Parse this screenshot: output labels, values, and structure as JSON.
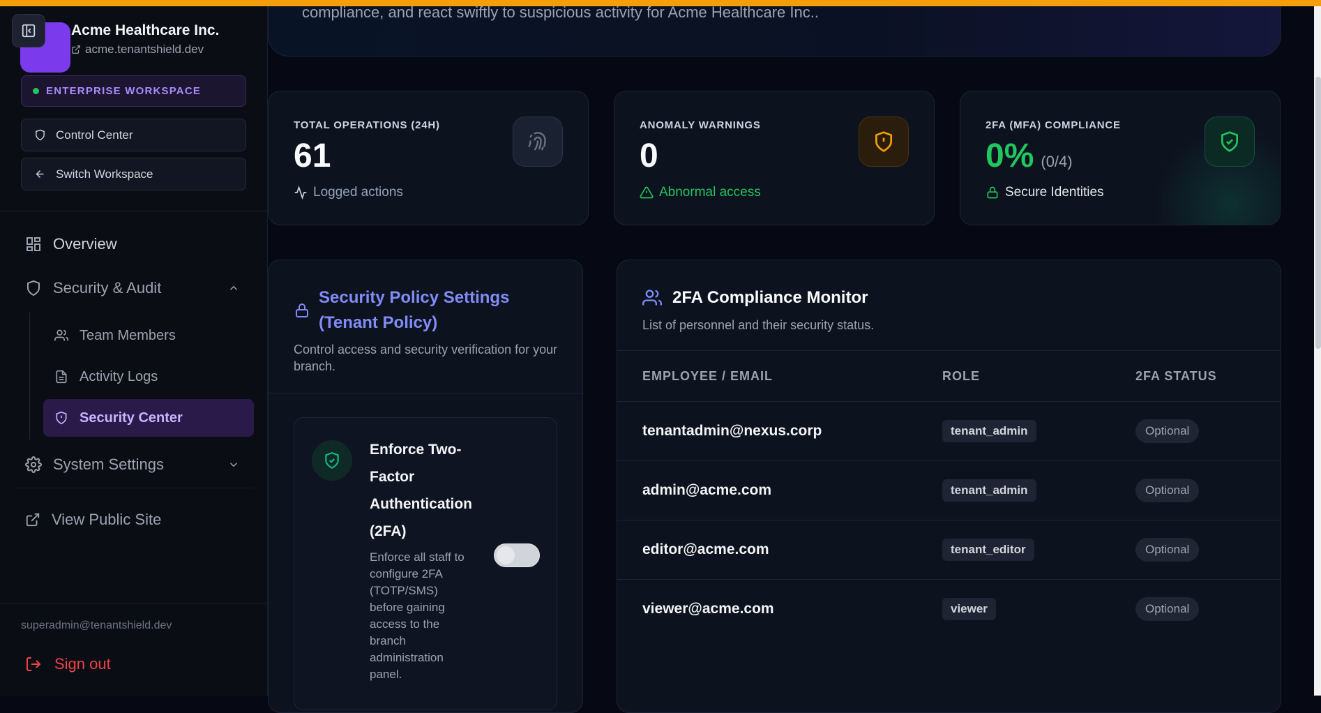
{
  "brand": {
    "name": "Acme Healthcare Inc.",
    "url": "acme.tenantshield.dev"
  },
  "workspace_badge": "ENTERPRISE WORKSPACE",
  "sidebar_buttons": {
    "control_center": "Control Center",
    "switch_workspace": "Switch Workspace"
  },
  "nav": {
    "overview": "Overview",
    "security_audit": "Security & Audit",
    "team_members": "Team Members",
    "activity_logs": "Activity Logs",
    "security_center": "Security Center",
    "system_settings": "System Settings",
    "view_public_site": "View Public Site"
  },
  "user": {
    "email": "superadmin@tenantshield.dev",
    "sign_out": "Sign out"
  },
  "hero": {
    "text": "compliance, and react swiftly to suspicious activity for Acme Healthcare Inc.."
  },
  "stats": [
    {
      "label": "TOTAL OPERATIONS (24H)",
      "value": "61",
      "sub": "Logged actions"
    },
    {
      "label": "ANOMALY WARNINGS",
      "value": "0",
      "sub": "Abnormal access"
    },
    {
      "label": "2FA (MFA) COMPLIANCE",
      "value": "0%",
      "ratio": "(0/4)",
      "sub": "Secure Identities"
    }
  ],
  "policy": {
    "title": "Security Policy Settings (Tenant Policy)",
    "description": "Control access and security verification for your branch.",
    "mfa_title": "Enforce Two-Factor Authentication (2FA)",
    "mfa_description": "Enforce all staff to configure 2FA (TOTP/SMS) before gaining access to the branch administration panel.",
    "mfa_enabled": false
  },
  "monitor": {
    "title": "2FA Compliance Monitor",
    "subtitle": "List of personnel and their security status.",
    "columns": [
      "EMPLOYEE / EMAIL",
      "ROLE",
      "2FA STATUS"
    ],
    "rows": [
      {
        "email": "tenantadmin@nexus.corp",
        "role": "tenant_admin",
        "status": "Optional"
      },
      {
        "email": "admin@acme.com",
        "role": "tenant_admin",
        "status": "Optional"
      },
      {
        "email": "editor@acme.com",
        "role": "tenant_editor",
        "status": "Optional"
      },
      {
        "email": "viewer@acme.com",
        "role": "viewer",
        "status": "Optional"
      }
    ]
  },
  "colors": {
    "accent": "#7c3aed",
    "warning": "#f59e0b",
    "success": "#22c55e",
    "danger": "#ef4444"
  }
}
